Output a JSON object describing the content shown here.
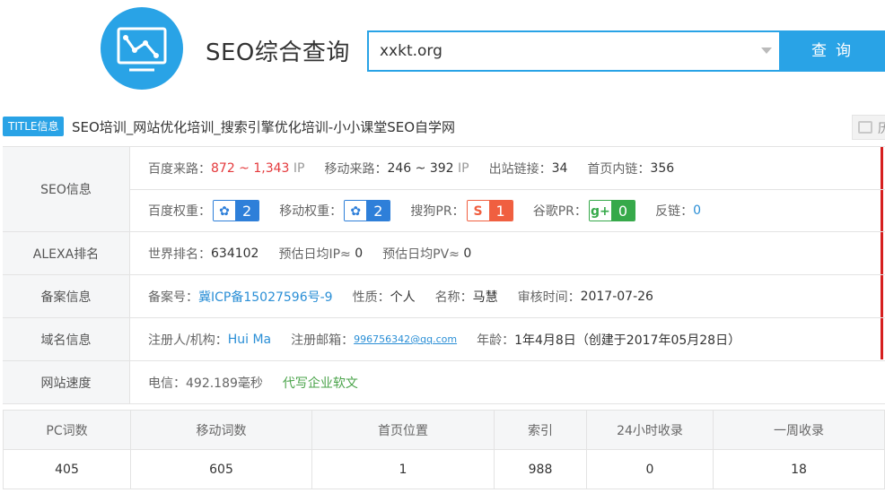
{
  "header": {
    "app_title": "SEO综合查询",
    "search_value": "xxkt.org",
    "search_button": "查询",
    "logo_icon": "chart-monitor-icon"
  },
  "title_row": {
    "badge": "TITLE信息",
    "site_title": "SEO培训_网站优化培训_搜索引擎优化培训-小小课堂SEO自学网",
    "corner_text": "历"
  },
  "seo_info": {
    "label": "SEO信息",
    "baidu_traffic_label": "百度来路：",
    "baidu_traffic_value": "872 ~ 1,343",
    "baidu_traffic_unit": "IP",
    "mobile_traffic_label": "移动来路：",
    "mobile_traffic_value": "246 ~ 392",
    "mobile_traffic_unit": "IP",
    "outbound_label": "出站链接：",
    "outbound_value": "34",
    "inbound_label": "首页内链：",
    "inbound_value": "356",
    "baidu_weight_label": "百度权重：",
    "baidu_weight_value": "2",
    "mobile_weight_label": "移动权重：",
    "mobile_weight_value": "2",
    "sogou_pr_label": "搜狗PR：",
    "sogou_pr_value": "1",
    "google_pr_label": "谷歌PR：",
    "google_pr_value": "0",
    "backlinks_label": "反链：",
    "backlinks_value": "0",
    "colors": {
      "baidu": "#2e7fd9",
      "sogou": "#f05f40",
      "google": "#36a94a"
    }
  },
  "alexa": {
    "label": "ALEXA排名",
    "world_rank_label": "世界排名：",
    "world_rank_value": "634102",
    "daily_ip_label": "预估日均IP≈",
    "daily_ip_value": "0",
    "daily_pv_label": "预估日均PV≈",
    "daily_pv_value": "0"
  },
  "icp": {
    "label": "备案信息",
    "number_label": "备案号：",
    "number_value": "冀ICP备15027596号-9",
    "nature_label": "性质：",
    "nature_value": "个人",
    "name_label": "名称：",
    "name_value": "马慧",
    "audit_label": "审核时间：",
    "audit_value": "2017-07-26"
  },
  "domain": {
    "label": "域名信息",
    "registrant_label": "注册人/机构：",
    "registrant_value": "Hui Ma",
    "email_label": "注册邮箱：",
    "email_value": "996756342@qq.com",
    "age_label": "年龄：",
    "age_value": "1年4月8日",
    "created_note": "（创建于2017年05月28日）"
  },
  "speed": {
    "label": "网站速度",
    "telecom_label": "电信：",
    "telecom_value": "492.189毫秒",
    "ad_link": "代写企业软文"
  },
  "stats": {
    "headers": [
      "PC词数",
      "移动词数",
      "首页位置",
      "索引",
      "24小时收录",
      "一周收录"
    ],
    "values": [
      "405",
      "605",
      "1",
      "988",
      "0",
      "18"
    ]
  }
}
